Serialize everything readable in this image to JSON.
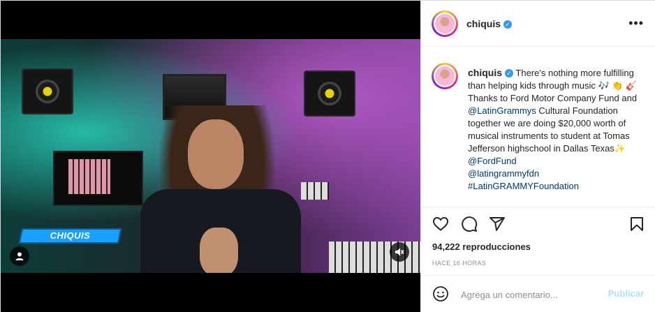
{
  "post": {
    "username": "chiquis",
    "caption_pre_emoji": "There's nothing more fulfilling than helping kids through music",
    "caption_emojis": "🎶 👏 🎸",
    "caption_mid": "Thanks to Ford Motor Company Fund and",
    "mention_latingrammys": "@LatinGrammys",
    "caption_post": "Cultural Foundation together we are doing $20,000 worth of musical instruments to student at Tomas Jefferson highschool in Dallas Texas",
    "caption_end_emoji": "✨",
    "mention_fordfund": "@FordFund",
    "mention_latingrammyfdn": "@latingrammyfdn",
    "hashtag": "#LatinGRAMMYFoundation",
    "views": "94,222 reproducciones",
    "time_ago": "HACE 16 HORAS"
  },
  "video": {
    "banner_name": "CHIQUIS"
  },
  "comment": {
    "placeholder": "Agrega un comentario...",
    "publish_label": "Publicar"
  },
  "icons": {
    "more": "more-options-icon",
    "like": "heart-icon",
    "comment": "comment-icon",
    "share": "share-icon",
    "save": "bookmark-icon",
    "emoji": "emoji-icon",
    "user_tag": "user-tag-icon",
    "mute": "mute-icon",
    "verified": "verified-badge-icon"
  },
  "colors": {
    "verified": "#3897f0",
    "link": "#00376b",
    "publish_disabled": "#b2dffc",
    "banner": "#1aa1ff"
  }
}
